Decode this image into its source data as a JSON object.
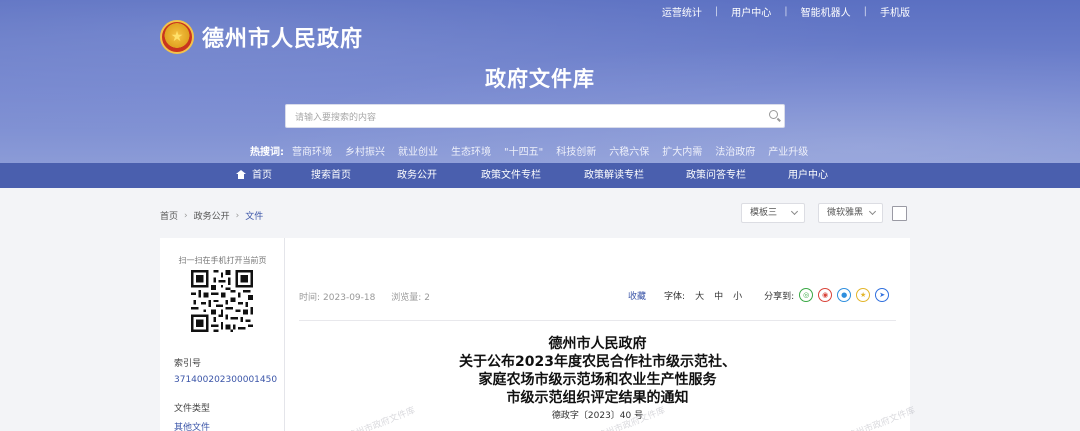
{
  "colors": {
    "banner": "#6d80cc",
    "nav": "#4a5fae",
    "accent": "#3b55a8",
    "sidebar": "#ffffff"
  },
  "topbar": [
    "运营统计",
    "用户中心",
    "智能机器人",
    "手机版"
  ],
  "site": {
    "title": "德州市人民政府",
    "emblem_icon": "national-emblem-icon"
  },
  "library_title": "政府文件库",
  "search": {
    "placeholder": "请输入要搜索的内容"
  },
  "hot": {
    "label": "热搜词:",
    "items": [
      "营商环境",
      "乡村振兴",
      "就业创业",
      "生态环境",
      "\"十四五\"",
      "科技创新",
      "六稳六保",
      "扩大内需",
      "法治政府",
      "产业升级"
    ]
  },
  "nav": [
    "首页",
    "搜索首页",
    "政务公开",
    "政策文件专栏",
    "政策解读专栏",
    "政策问答专栏",
    "用户中心"
  ],
  "breadcrumb": [
    "首页",
    "政务公开",
    "文件"
  ],
  "selects": {
    "template": "模板三",
    "font": "微软雅黑"
  },
  "sidebar": {
    "scan_tip": "扫一扫在手机打开当前页",
    "index_label": "索引号",
    "index_value": "371400202300001450",
    "type_label": "文件类型",
    "type_value": "其他文件"
  },
  "article": {
    "time_label": "时间:",
    "time_value": "2023-09-18",
    "views_label": "浏览量:",
    "views_value": "2",
    "collect": "收藏",
    "font_label": "字体:",
    "font_large": "大",
    "font_medium": "中",
    "font_small": "小",
    "share_label": "分享到:",
    "title_lines": [
      "德州市人民政府",
      "关于公布2023年度农民合作社市级示范社、",
      "家庭农场市级示范场和农业生产性服务",
      "市级示范组织评定结果的通知"
    ],
    "doc_number": "德政字〔2023〕40 号",
    "watermark": "德州市政府文件库"
  }
}
